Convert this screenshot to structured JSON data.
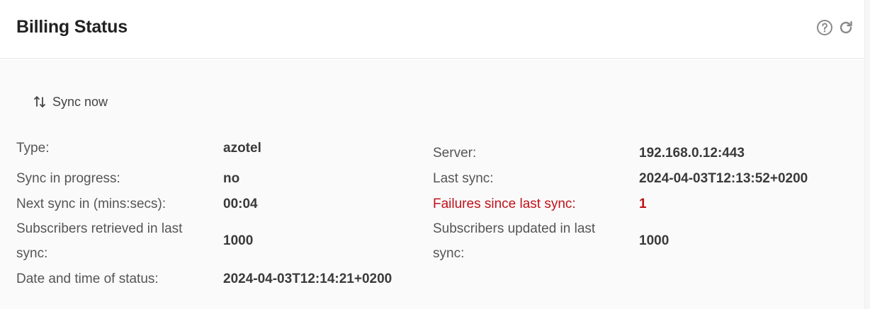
{
  "header": {
    "title": "Billing Status",
    "help_icon": "help-circle-icon",
    "refresh_icon": "refresh-icon"
  },
  "actions": {
    "sync_now_label": "Sync now",
    "sync_icon": "arrows-up-down-icon"
  },
  "left": {
    "type_label": "Type:",
    "type_value": "azotel",
    "sync_in_progress_label": "Sync in progress:",
    "sync_in_progress_value": "no",
    "next_sync_label": "Next sync in (mins:secs):",
    "next_sync_value": "00:04",
    "subs_retrieved_label_1": "Subscribers retrieved in last",
    "subs_retrieved_label_2": "sync:",
    "subs_retrieved_value": "1000",
    "status_time_label": "Date and time of status:",
    "status_time_value": "2024-04-03T12:14:21+0200"
  },
  "right": {
    "server_label": "Server:",
    "server_value": "192.168.0.12:443",
    "last_sync_label": "Last sync:",
    "last_sync_value": "2024-04-03T12:13:52+0200",
    "failures_label": "Failures since last sync:",
    "failures_value": "1",
    "subs_updated_label_1": "Subscribers updated in last",
    "subs_updated_label_2": "sync:",
    "subs_updated_value": "1000"
  },
  "colors": {
    "danger": "#c0121a",
    "body_bg": "#fafafa"
  }
}
